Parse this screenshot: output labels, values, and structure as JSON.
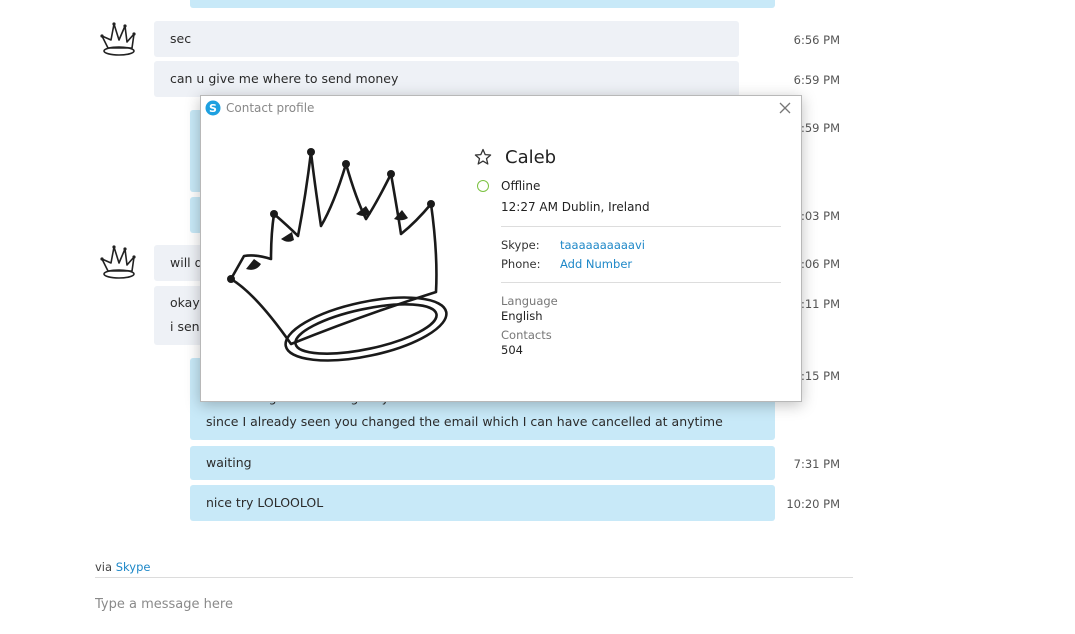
{
  "chat": {
    "messages_in": [
      {
        "text": "sec",
        "time": "6:56 PM"
      },
      {
        "text": "can u give me where to send money",
        "time": "6:59 PM"
      },
      {
        "text": "will d",
        "time": "7:06 PM"
      },
      {
        "line1": "okay",
        "line2": "i send",
        "time": "7:11 PM"
      }
    ],
    "messages_out": [
      {
        "time": "6:59 PM"
      },
      {
        "time": "7:03 PM"
      },
      {
        "line1": "I am sitting here waiting on you to do it",
        "line2": "since I already seen you changed the email which I can have cancelled at anytime",
        "time": "7:15 PM"
      },
      {
        "text": "waiting",
        "time": "7:31 PM"
      },
      {
        "text": "nice try LOLOOLOL",
        "time": "10:20 PM"
      }
    ]
  },
  "composer": {
    "via_prefix": "via",
    "via_link": "Skype",
    "placeholder": "Type a message here"
  },
  "profile": {
    "title": "Contact profile",
    "name": "Caleb",
    "status": "Offline",
    "local_time": "12:27 AM Dublin, Ireland",
    "skype_label": "Skype:",
    "skype_value": "taaaaaaaaaavi",
    "phone_label": "Phone:",
    "phone_value": "Add Number",
    "language_label": "Language",
    "language_value": "English",
    "contacts_label": "Contacts",
    "contacts_value": "504"
  },
  "colors": {
    "incoming_bubble": "#eef1f6",
    "outgoing_bubble": "#c8e9f8",
    "link": "#1e88c8",
    "status_offline": "#7cc242"
  },
  "icons": [
    "crown-avatar-icon",
    "skype-logo-icon",
    "close-icon",
    "star-icon",
    "status-dot-icon"
  ]
}
